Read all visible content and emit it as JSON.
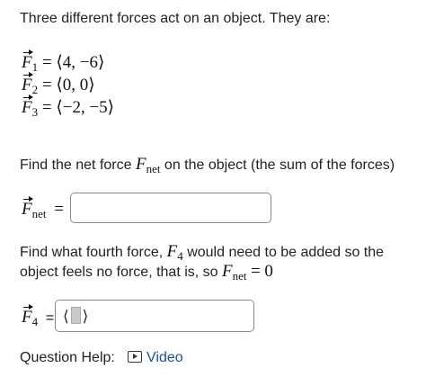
{
  "intro": "Three different forces act on an object. They are:",
  "forces": [
    {
      "name": "F",
      "sub": "1",
      "value": "= ⟨4, −6⟩"
    },
    {
      "name": "F",
      "sub": "2",
      "value": "= ⟨0, 0⟩"
    },
    {
      "name": "F",
      "sub": "3",
      "value": "= ⟨−2, −5⟩"
    }
  ],
  "q1": {
    "prompt_before": "Find the net force",
    "symbol": "F",
    "symbol_sub": "net",
    "prompt_after": "on the object (the sum of the forces)",
    "answer_label": "F",
    "answer_sub": "net",
    "answer_eq": "=",
    "answer_value": ""
  },
  "q2": {
    "line1_before": "Find what fourth force,",
    "line1_symbol": "F",
    "line1_sub": "4",
    "line1_after": "would need to be added so the",
    "line2_before": "object feels no force, that is, so",
    "line2_symbol": "F",
    "line2_sub": "net",
    "line2_after": "= 0",
    "answer_label": "F",
    "answer_sub": "4",
    "answer_eq": "=",
    "paren_open": "⟨",
    "paren_close": "⟩"
  },
  "help": {
    "label": "Question Help:",
    "link": "Video",
    "icon": "play-video-icon"
  }
}
